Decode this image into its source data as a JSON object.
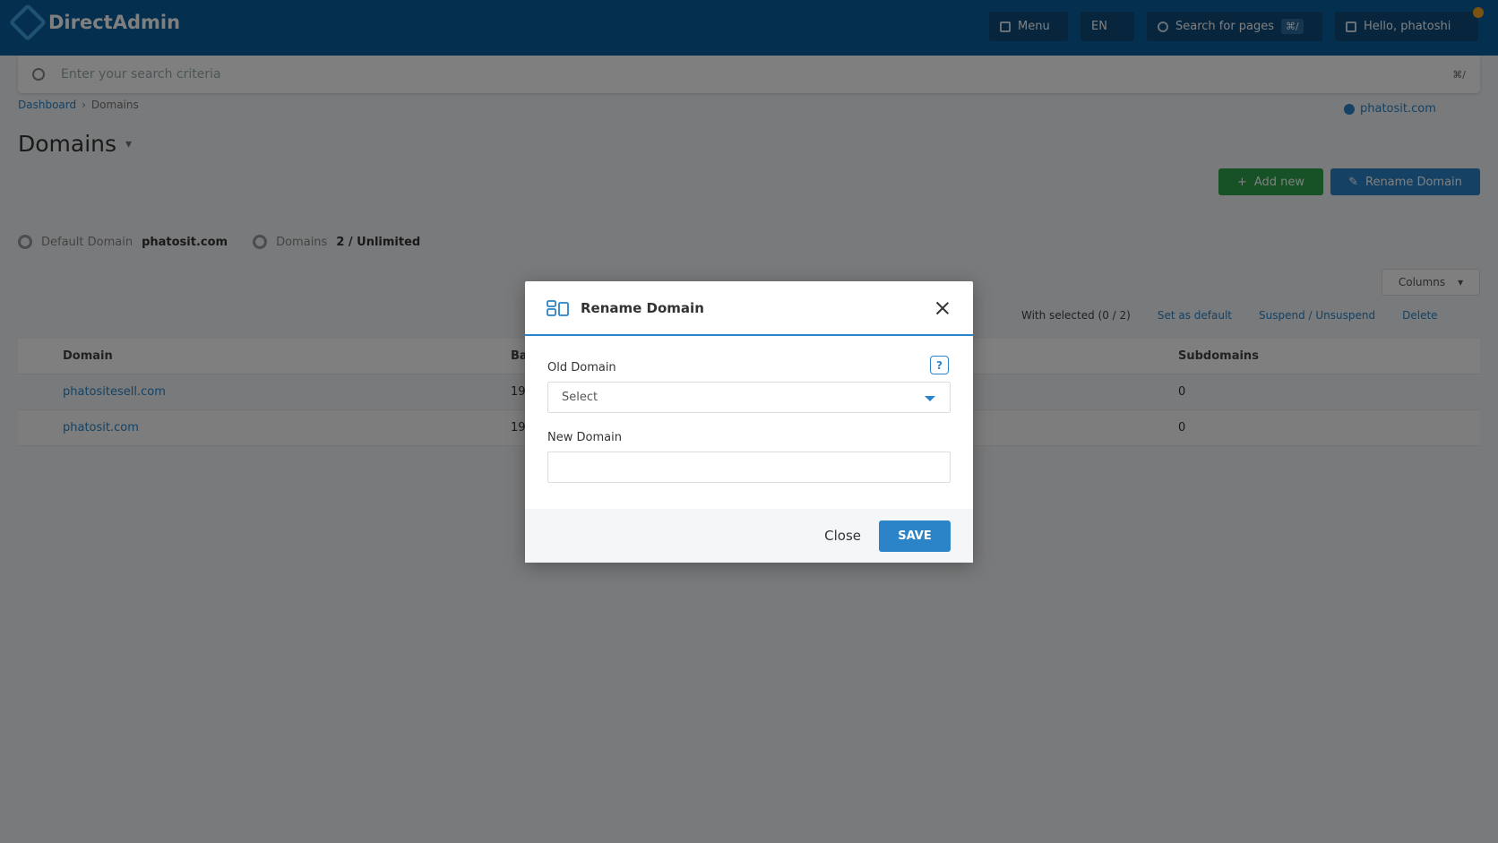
{
  "app": {
    "name": "DirectAdmin"
  },
  "header": {
    "menu_label": "Menu",
    "lang_label": "EN",
    "search_label": "Search for pages",
    "search_kbd": "⌘/",
    "user_label": "Hello, phatoshi"
  },
  "search": {
    "placeholder": "Enter your search criteria",
    "kbd": "⌘/"
  },
  "breadcrumb": {
    "home": "Dashboard",
    "current": "Domains"
  },
  "user_domain": "phatosit.com",
  "page": {
    "title": "Domains"
  },
  "actions": {
    "add": "Add new",
    "rename": "Rename Domain"
  },
  "stats": {
    "default_label": "Default Domain",
    "default_value": "phatosit.com",
    "domains_label": "Domains",
    "domains_value": "2 / Unlimited"
  },
  "table": {
    "columns_button": "Columns",
    "selected": "With selected (0 / 2)",
    "set_default": "Set as default",
    "suspend": "Suspend / Unsuspend",
    "delete": "Delete",
    "headers": [
      "Domain",
      "Bandwidth",
      "Subdomains"
    ],
    "rows": [
      {
        "domain": "phatositesell.com",
        "bandwidth": "19",
        "subdomains": "0"
      },
      {
        "domain": "phatosit.com",
        "bandwidth": "19",
        "subdomains": "0"
      }
    ]
  },
  "modal": {
    "title": "Rename Domain",
    "old_domain_label": "Old Domain",
    "old_domain_value": "Select",
    "new_domain_label": "New Domain",
    "new_domain_value": "",
    "help_label": "?",
    "close_label": "Close",
    "save_label": "SAVE"
  },
  "colors": {
    "header": "#0a5f9c",
    "accent": "#2b84c8",
    "green": "#2ea44f"
  }
}
